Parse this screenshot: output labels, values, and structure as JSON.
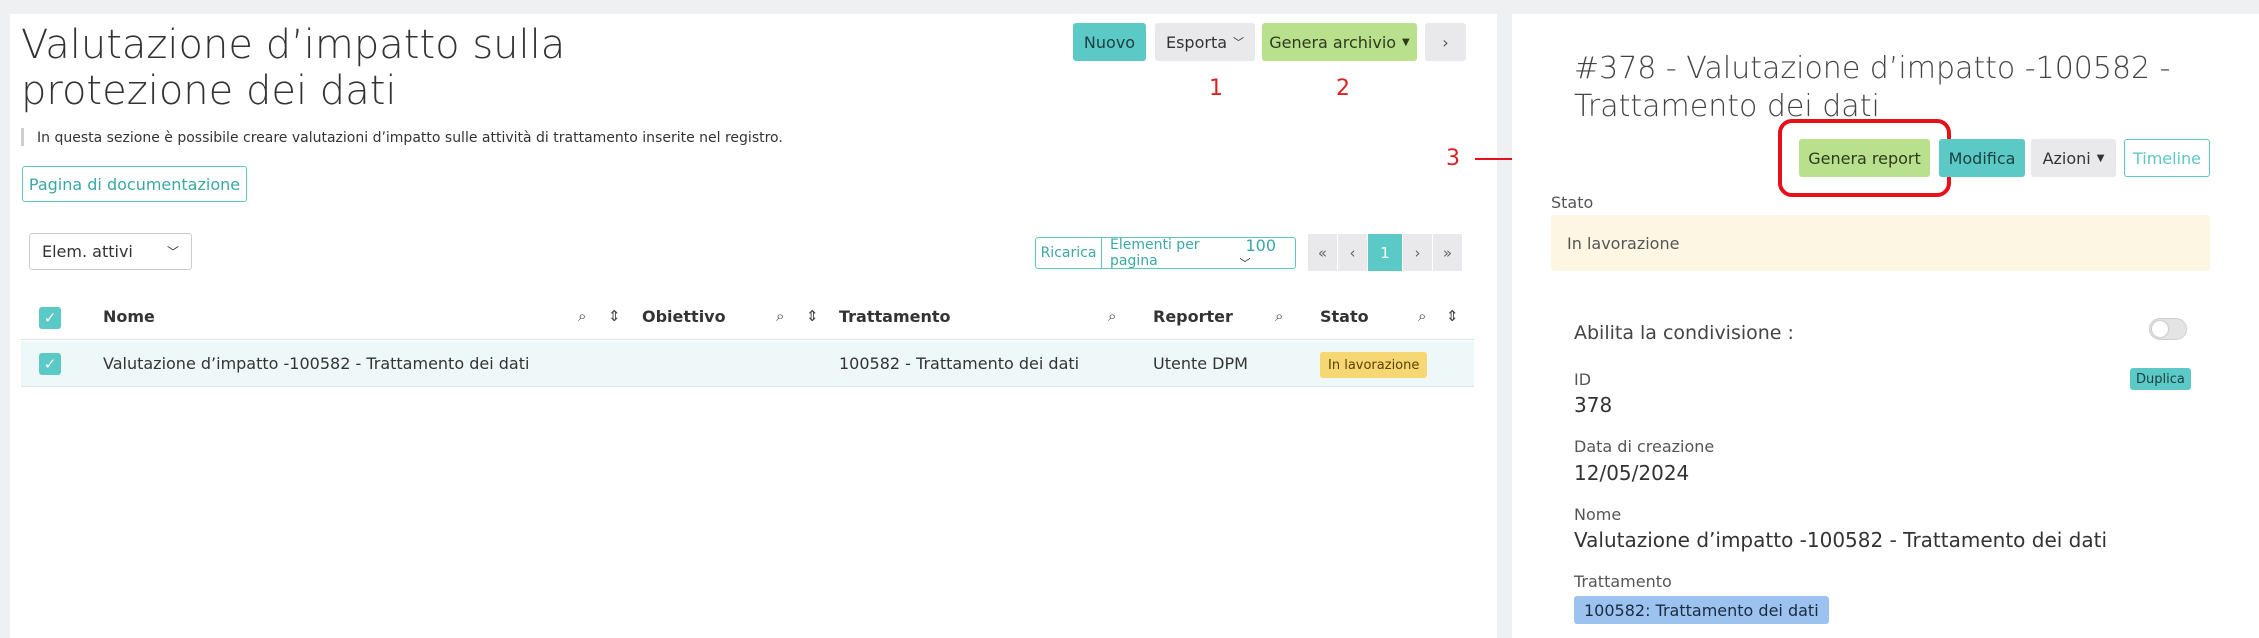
{
  "left": {
    "title": "Valutazione d’impatto sulla protezione dei dati",
    "description": "In questa sezione è possibile creare valutazioni d’impatto sulle attività di trattamento inserite nel registro.",
    "doc_button": "Pagina di documentazione",
    "toolbar": {
      "nuovo": "Nuovo",
      "esporta": "Esporta",
      "genera_archivio": "Genera archivio",
      "next": "›"
    },
    "annotations": {
      "one": "1",
      "two": "2",
      "three": "3"
    },
    "filter_select": "Elem. attivi",
    "reload": "Ricarica",
    "per_page_label": "Elementi per pagina",
    "per_page_value": "100",
    "pager": {
      "first": "«",
      "prev": "‹",
      "current": "1",
      "next": "›",
      "last": "»"
    },
    "table": {
      "headers": {
        "nome": "Nome",
        "obiettivo": "Obiettivo",
        "trattamento": "Trattamento",
        "reporter": "Reporter",
        "stato": "Stato"
      },
      "rows": [
        {
          "nome": "Valutazione d’impatto -100582 - Trattamento dei dati",
          "obiettivo": "",
          "trattamento": "100582 - Trattamento dei dati",
          "reporter": "Utente DPM",
          "stato": "In lavorazione"
        }
      ]
    }
  },
  "right": {
    "title": "#378 - Valutazione d’impatto -100582 - Trattamento dei dati",
    "buttons": {
      "genera_report": "Genera report",
      "modifica": "Modifica",
      "azioni": "Azioni",
      "timeline": "Timeline"
    },
    "stato_label": "Stato",
    "stato_value": "In lavorazione",
    "condivisione_label": "Abilita la condivisione :",
    "id_label": "ID",
    "id_value": "378",
    "duplica": "Duplica",
    "data_label": "Data di creazione",
    "data_value": "12/05/2024",
    "nome_label": "Nome",
    "nome_value": "Valutazione d’impatto -100582 - Trattamento dei dati",
    "trattamento_label": "Trattamento",
    "trattamento_value": "100582: Trattamento dei dati"
  },
  "colors": {
    "accent": "#5bc9c6",
    "green": "#b9e08d",
    "annotation": "#e5101a",
    "status_badge": "#f7d774"
  }
}
